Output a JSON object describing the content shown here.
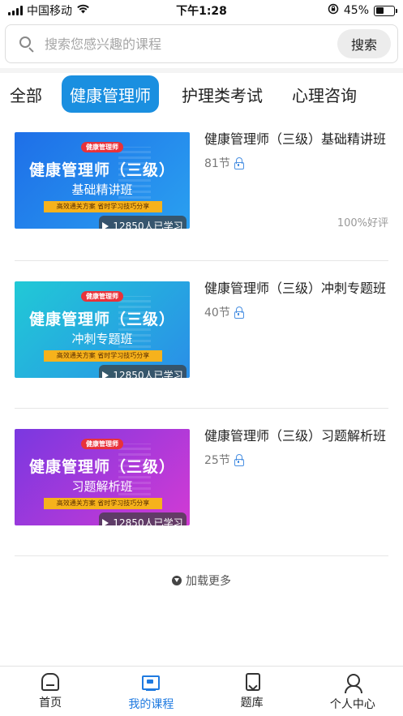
{
  "status_bar": {
    "carrier": "中国移动",
    "time": "下午1:28",
    "battery": "45%",
    "battery_level": 0.45
  },
  "search": {
    "placeholder": "搜索您感兴趣的课程",
    "button_label": "搜索"
  },
  "tabs": [
    {
      "label": "全部",
      "active": false
    },
    {
      "label": "健康管理师",
      "active": true
    },
    {
      "label": "护理类考试",
      "active": false
    },
    {
      "label": "心理咨询",
      "active": false
    }
  ],
  "courses": [
    {
      "title": "健康管理师（三级）基础精讲班",
      "lessons": "81节",
      "rating": "100%好评",
      "thumb": {
        "tag": "健康管理师",
        "headline": "健康管理师（三级）",
        "subtitle": "基础精讲班",
        "slogan": "高效通关方案  省时学习技巧分享",
        "learners": "12850人已学习"
      }
    },
    {
      "title": "健康管理师（三级）冲刺专题班",
      "lessons": "40节",
      "rating": "",
      "thumb": {
        "tag": "健康管理师",
        "headline": "健康管理师（三级）",
        "subtitle": "冲刺专题班",
        "slogan": "高效通关方案  省时学习技巧分享",
        "learners": "12850人已学习"
      }
    },
    {
      "title": "健康管理师（三级）习题解析班",
      "lessons": "25节",
      "rating": "",
      "thumb": {
        "tag": "健康管理师",
        "headline": "健康管理师（三级）",
        "subtitle": "习题解析班",
        "slogan": "高效通关方案  省时学习技巧分享",
        "learners": "12850人已学习"
      }
    }
  ],
  "load_more": "加载更多",
  "bottom_nav": [
    {
      "label": "首页",
      "icon": "home-icon",
      "active": false
    },
    {
      "label": "我的课程",
      "icon": "course-icon",
      "active": true
    },
    {
      "label": "题库",
      "icon": "question-bank-icon",
      "active": false
    },
    {
      "label": "个人中心",
      "icon": "user-icon",
      "active": false
    }
  ],
  "colors": {
    "accent": "#1a8fe0",
    "nav_active": "#1f7ae0",
    "lock": "#4a90e2"
  }
}
